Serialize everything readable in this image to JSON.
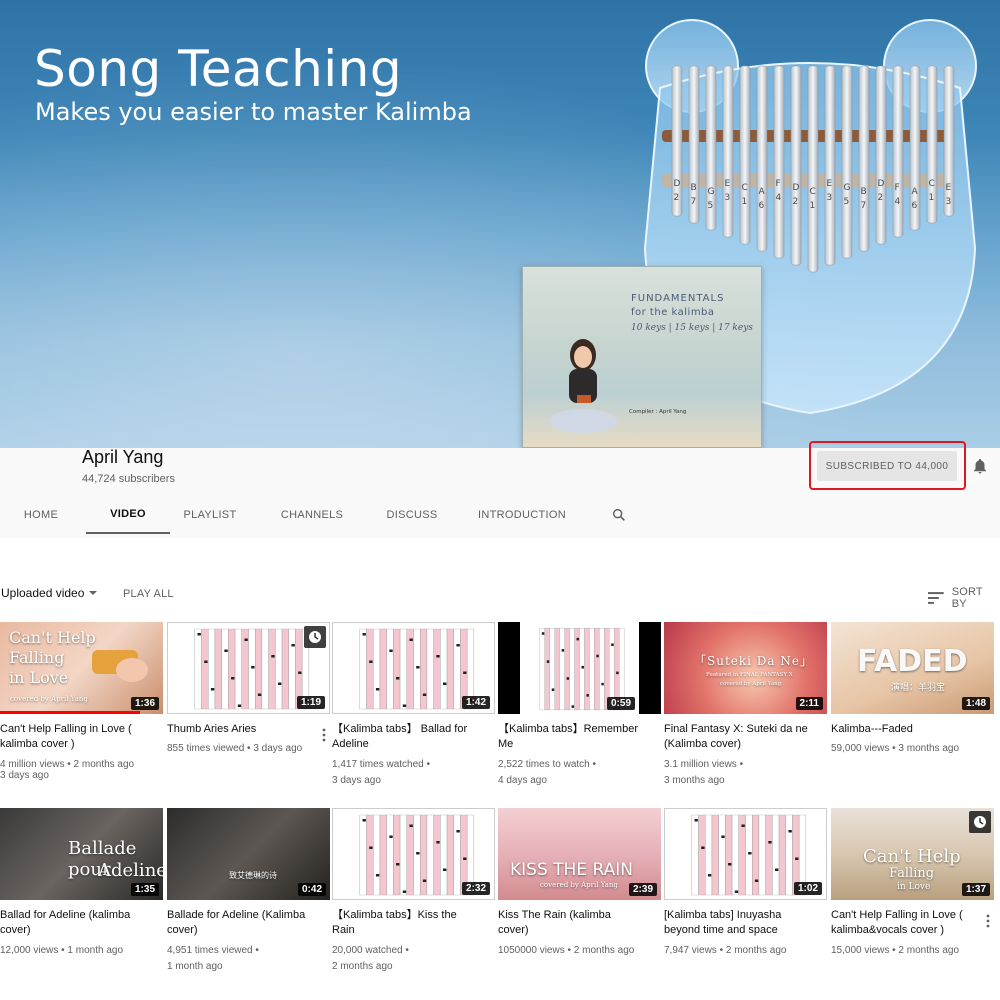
{
  "banner": {
    "title": "Song Teaching",
    "subtitle": "Makes you easier to master Kalimba",
    "book": {
      "title": "FUNDAMENTALS",
      "subtitle": "for the kalimba",
      "keys": "10 keys | 15 keys | 17 keys",
      "compiler": "Compiler : April Yang"
    },
    "tine_notes": [
      "D2",
      "B7",
      "G5",
      "E3",
      "C1",
      "A6",
      "F4",
      "D2",
      "C1",
      "E3",
      "G5",
      "B7",
      "D2",
      "F4",
      "A6",
      "C1",
      "E3"
    ]
  },
  "channel": {
    "name": "April Yang",
    "subscribers": "44,724 subscribers",
    "subscribe_label": "SUBSCRIBED TO  44,000",
    "accent": "#e0171f"
  },
  "tabs": [
    {
      "label": "HOME"
    },
    {
      "label": "VIDEO",
      "active": true
    },
    {
      "label": "PLAYLIST"
    },
    {
      "label": "CHANNELS"
    },
    {
      "label": "DISCUSS"
    },
    {
      "label": "INTRODUCTION"
    }
  ],
  "filters": {
    "uploaded": "Uploaded video",
    "play_all": "PLAY ALL",
    "sort_by": "SORT BY"
  },
  "videos": [
    {
      "title1": "Can't Help Falling in Love (",
      "title2": "kalimba cover )",
      "meta1": "4 million views  •  2 months ago",
      "meta2": "3 days ago",
      "duration": "1:36",
      "thumb_text1": "Can't Help",
      "thumb_text2": "Falling",
      "thumb_text3": "in Love",
      "thumb_text4": "covered by April Yang"
    },
    {
      "title1": "Thumb Aries Aries",
      "title2": "",
      "meta1": "855 times viewed  •  3 days ago",
      "meta2": "",
      "duration": "1:19"
    },
    {
      "title1": "【Kalimba tabs】 Ballad for",
      "title2": "Adeline",
      "meta1": "1,417 times watched  •",
      "meta2": "3 days ago",
      "duration": "1:42"
    },
    {
      "title1": "【Kalimba tabs】Remember",
      "title2": "Me",
      "meta1": "2,522 times to watch  •",
      "meta2": "4 days ago",
      "duration": "0:59"
    },
    {
      "title1": "Final Fantasy X: Suteki da ne",
      "title2": "(Kalimba cover)",
      "meta1": "3.1 million views  •",
      "meta2": "3 months ago",
      "duration": "2:11",
      "thumb_text1": "「Suteki Da Ne」",
      "thumb_text2": "Featured in FINAL FANTASY X",
      "thumb_text3": "covered by April Yang"
    },
    {
      "title1": "Kalimba---Faded",
      "title2": "",
      "meta1": "59,000 views  •  3 months ago",
      "meta2": "",
      "duration": "1:48",
      "thumb_text1": "FADED",
      "thumb_text2": "演唱：羊羽宝"
    },
    {
      "title1": "Ballad for Adeline (kalimba",
      "title2": "cover)",
      "meta1": "12,000 views  •  1 month ago",
      "meta2": "",
      "duration": "1:35",
      "thumb_text1": "Ballade pour",
      "thumb_text2": "Adeline"
    },
    {
      "title1": "Ballade for Adeline (Kalimba",
      "title2": "cover)",
      "meta1": "4,951 times viewed  •",
      "meta2": "1 month ago",
      "duration": "0:42",
      "thumb_text1": "致艾德琳的诗"
    },
    {
      "title1": "【Kalimba tabs】Kiss the",
      "title2": "Rain",
      "meta1": "20,000 watched  •",
      "meta2": "2 months ago",
      "duration": "2:32"
    },
    {
      "title1": "Kiss The Rain (kalimba",
      "title2": "cover)",
      "meta1": "1050000 views  •  2 months ago",
      "meta2": "",
      "duration": "2:39",
      "thumb_text1": "KISS THE RAIN",
      "thumb_text2": "covered by April Yang"
    },
    {
      "title1": "[Kalimba tabs] Inuyasha",
      "title2": "beyond time and space",
      "meta1": "7,947 views  •  2 months ago",
      "meta2": "",
      "duration": "1:02"
    },
    {
      "title1": "Can't Help Falling in Love (",
      "title2": "kalimba&vocals cover )",
      "meta1": "15,000 views  •  2 months ago",
      "meta2": "",
      "duration": "1:37",
      "thumb_text1": "Can't Help",
      "thumb_text2": "Falling",
      "thumb_text3": "in Love"
    }
  ]
}
